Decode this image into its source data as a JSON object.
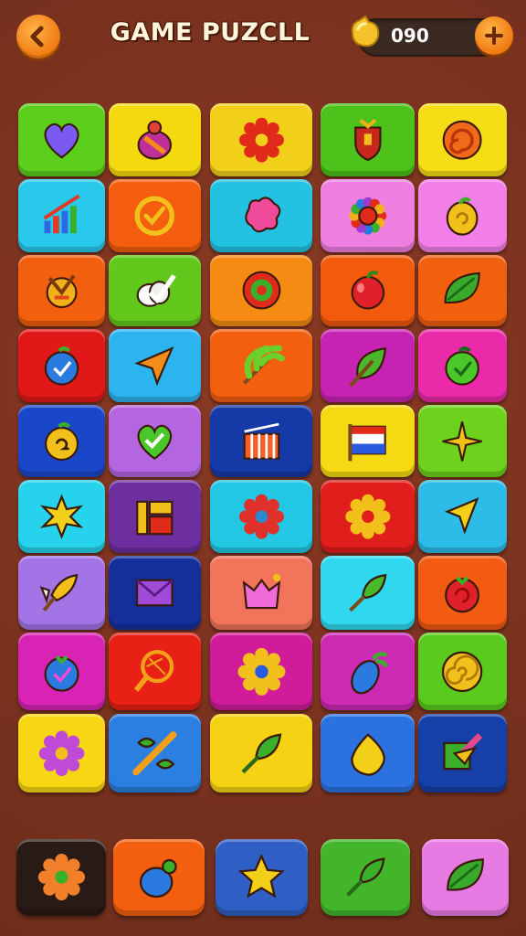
{
  "header": {
    "title": "GAME PUZCLL",
    "coins": "090",
    "back_icon": "back-arrow-icon",
    "coin_icon": "gold-coin-icon",
    "add_icon": "plus-icon"
  },
  "board": {
    "rows": [
      [
        {
          "color": "#5ccf1d",
          "icon": "heart-icon"
        },
        {
          "color": "#f5d90f",
          "icon": "fruit-icon"
        },
        {
          "color": "#f2d01a",
          "icon": "red-gear-icon"
        },
        {
          "color": "#4cc21a",
          "icon": "shield-icon"
        },
        {
          "color": "#f6de16",
          "icon": "swirl-icon"
        }
      ],
      [
        {
          "color": "#29c9ec",
          "icon": "bar-chart-icon"
        },
        {
          "color": "#f45e0e",
          "icon": "check-circle-icon"
        },
        {
          "color": "#23c2e2",
          "icon": "blob-icon"
        },
        {
          "color": "#ee7fe0",
          "icon": "flower-icon"
        },
        {
          "color": "#f27fe8",
          "icon": "lemon-icon"
        }
      ],
      [
        {
          "color": "#f2600f",
          "icon": "emblem-icon"
        },
        {
          "color": "#62c91c",
          "icon": "egg-check-icon"
        },
        {
          "color": "#f58b12",
          "icon": "target-icon"
        },
        {
          "color": "#f25a0e",
          "icon": "apple-icon"
        },
        {
          "color": "#f0600f",
          "icon": "leaf-icon"
        }
      ],
      [
        {
          "color": "#e21818",
          "icon": "blueberry-icon"
        },
        {
          "color": "#2cb4ef",
          "icon": "arrow-icon"
        },
        {
          "color": "#f2600f",
          "icon": "palm-leaf-icon"
        },
        {
          "color": "#c623b3",
          "icon": "green-leaf-icon"
        },
        {
          "color": "#ea2aa8",
          "icon": "green-fruit-icon"
        }
      ],
      [
        {
          "color": "#1a47c9",
          "icon": "yellow-fruit-icon"
        },
        {
          "color": "#b466e0",
          "icon": "heart-check-icon"
        },
        {
          "color": "#153aa8",
          "icon": "bars-icon"
        },
        {
          "color": "#f4d913",
          "icon": "flag-icon"
        },
        {
          "color": "#6ed11e",
          "icon": "star-spark-icon"
        }
      ],
      [
        {
          "color": "#27d2ec",
          "icon": "star-burst-icon"
        },
        {
          "color": "#6d2ea0",
          "icon": "blocks-icon"
        },
        {
          "color": "#22c7e4",
          "icon": "gear-icon"
        },
        {
          "color": "#e01e1c",
          "icon": "sun-gear-icon"
        },
        {
          "color": "#2dbbe8",
          "icon": "cursor-icon"
        }
      ],
      [
        {
          "color": "#a374e6",
          "icon": "rocket-icon"
        },
        {
          "color": "#152f9a",
          "icon": "envelope-icon"
        },
        {
          "color": "#f2745a",
          "icon": "pink-heart-icon"
        },
        {
          "color": "#2fd8ee",
          "icon": "pencil-arrow-icon"
        },
        {
          "color": "#f35a12",
          "icon": "tomato-icon"
        }
      ],
      [
        {
          "color": "#d823b5",
          "icon": "plum-icon"
        },
        {
          "color": "#e82016",
          "icon": "racket-icon"
        },
        {
          "color": "#d11c9a",
          "icon": "flower-gear-icon"
        },
        {
          "color": "#cc2ab2",
          "icon": "pepper-icon"
        },
        {
          "color": "#5acb1c",
          "icon": "spiral-icon"
        }
      ],
      [
        {
          "color": "#f7d614",
          "icon": "cog-icon"
        },
        {
          "color": "#2a7fe0",
          "icon": "cross-arrows-icon"
        },
        {
          "color": "#f6d214",
          "icon": "green-arrow-icon"
        },
        {
          "color": "#2b72e0",
          "icon": "lemon-drop-icon"
        },
        {
          "color": "#163fa8",
          "icon": "puzzle-arrow-icon"
        }
      ]
    ]
  },
  "tray": {
    "items": [
      {
        "color": "#2a1a15",
        "icon": "gear-fruit-icon"
      },
      {
        "color": "#f2600f",
        "icon": "blue-berry-icon"
      },
      {
        "color": "#2f5ec4",
        "icon": "star-icon"
      },
      {
        "color": "#43b52a",
        "icon": "green-arrow-icon"
      },
      {
        "color": "#e87ae4",
        "icon": "leaf-icon"
      }
    ]
  }
}
